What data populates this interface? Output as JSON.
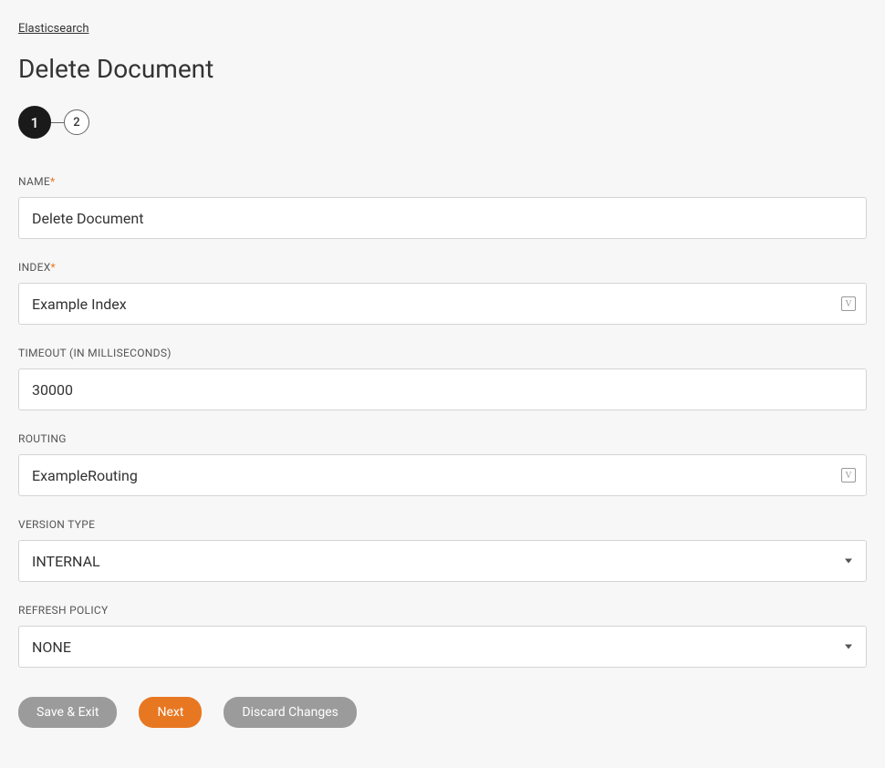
{
  "breadcrumb": "Elasticsearch",
  "pageTitle": "Delete Document",
  "stepper": {
    "step1": "1",
    "step2": "2"
  },
  "fields": {
    "name": {
      "label": "NAME",
      "value": "Delete Document",
      "required": true
    },
    "index": {
      "label": "INDEX",
      "value": "Example Index",
      "required": true,
      "hasVarIcon": true
    },
    "timeout": {
      "label": "TIMEOUT (IN MILLISECONDS)",
      "value": "30000",
      "required": false
    },
    "routing": {
      "label": "ROUTING",
      "value": "ExampleRouting",
      "required": false,
      "hasVarIcon": true
    },
    "versionType": {
      "label": "VERSION TYPE",
      "value": "INTERNAL",
      "required": false
    },
    "refreshPolicy": {
      "label": "REFRESH POLICY",
      "value": "NONE",
      "required": false
    }
  },
  "buttons": {
    "saveExit": "Save & Exit",
    "next": "Next",
    "discard": "Discard Changes"
  },
  "requiredMark": "*",
  "varIconGlyph": "V"
}
